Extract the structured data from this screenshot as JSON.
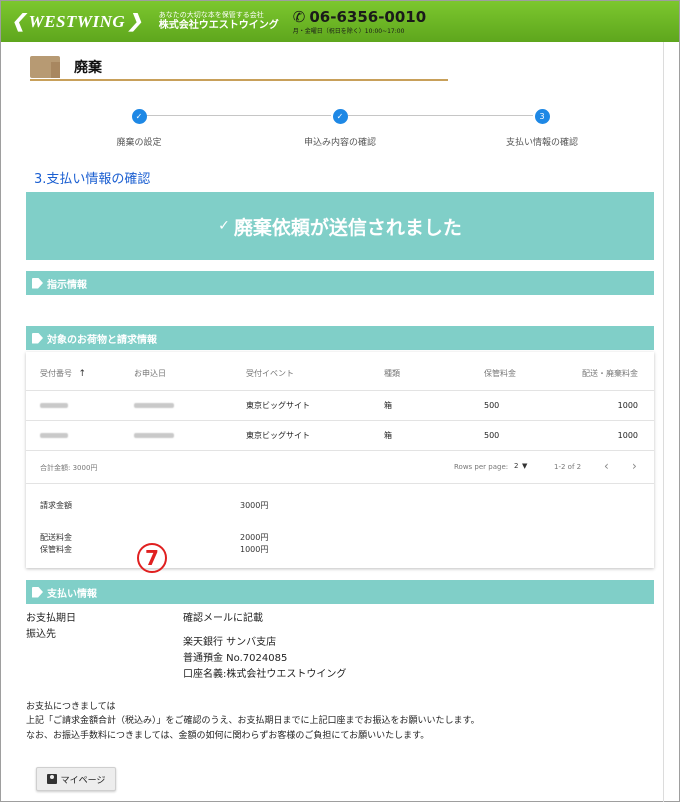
{
  "header": {
    "logo_text": "WESTWING",
    "tagline": "あなたの大切な本を保管する会社",
    "company_name": "株式会社ウエストウイング",
    "phone": "06-6356-0010",
    "hours": "月・金曜日（祝日を除く）10:00~17:00"
  },
  "page": {
    "title": "廃棄"
  },
  "stepper": {
    "steps": [
      {
        "label": "廃棄の設定",
        "icon": "check-icon"
      },
      {
        "label": "申込み内容の確認",
        "icon": "check-icon"
      },
      {
        "label": "支払い情報の確認",
        "number": "3"
      }
    ]
  },
  "section_heading": "3.支払い情報の確認",
  "banner": {
    "check": "✓",
    "text": "廃棄依頼が送信されました"
  },
  "sections": {
    "instructions": "指示情報",
    "items": "対象のお荷物と請求情報",
    "payment": "支払い情報"
  },
  "table": {
    "headers": [
      "受付番号",
      "お申込日",
      "受付イベント",
      "種類",
      "保管料金",
      "配送・廃棄料金"
    ],
    "sort_arrow": "↑",
    "rows": [
      {
        "event": "東京ビッグサイト",
        "type": "箱",
        "storage": "500",
        "delivery": "1000"
      },
      {
        "event": "東京ビッグサイト",
        "type": "箱",
        "storage": "500",
        "delivery": "1000"
      }
    ],
    "total_label": "合計金額: 3000円",
    "rows_per_page_label": "Rows per page:",
    "rows_per_page_value": "2",
    "range": "1-2 of 2"
  },
  "summary": {
    "billing_label": "請求金額",
    "billing_value": "3000円",
    "delivery_label": "配送料金",
    "delivery_value": "2000円",
    "storage_label": "保管料金",
    "storage_value": "1000円"
  },
  "marker": "7",
  "payment": {
    "due_label": "お支払期日",
    "due_value": "確認メールに記載",
    "transfer_label": "振込先",
    "bank": "楽天銀行 サンバ支店",
    "account": "普通預金 No.7024085",
    "holder": "口座名義:株式会社ウエストウイング"
  },
  "notes": {
    "line1": "お支払につきましては",
    "line2": "上記「ご請求金額合計（税込み）」をご確認のうえ、お支払期日までに上記口座までお振込をお願いいたします。",
    "line3": "なお、お振込手数料につきましては、金額の如何に関わらずお客様のご負担にてお願いいたします。"
  },
  "buttons": {
    "mypage": "マイページ"
  }
}
